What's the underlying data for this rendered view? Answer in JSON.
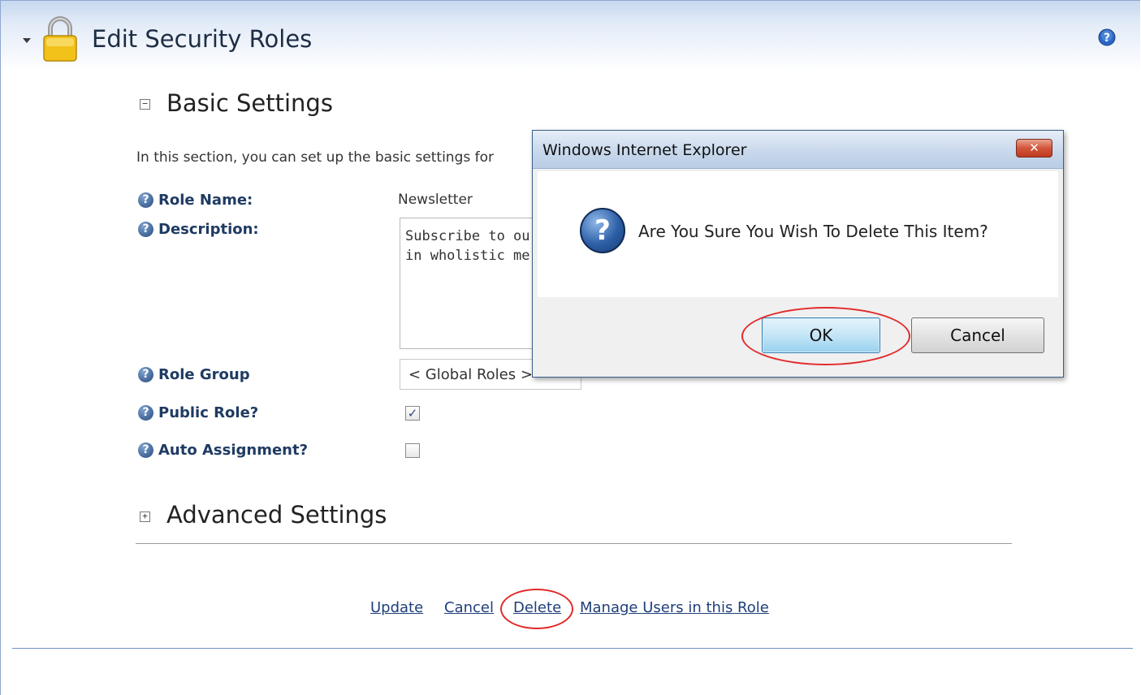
{
  "header": {
    "title": "Edit Security Roles"
  },
  "basic_settings": {
    "toggle": "−",
    "title": "Basic Settings",
    "intro": "In this section, you can set up the basic settings for"
  },
  "fields": {
    "role_name_label": "Role Name:",
    "role_name_value": "Newsletter",
    "description_label": "Description:",
    "description_value": "Subscribe to ou\nin wholistic me",
    "role_group_label": "Role Group",
    "role_group_value": "< Global Roles >",
    "public_role_label": "Public Role?",
    "public_role_checked": true,
    "auto_assignment_label": "Auto Assignment?",
    "auto_assignment_checked": false
  },
  "advanced_settings": {
    "toggle": "+",
    "title": "Advanced Settings"
  },
  "actions": {
    "update": "Update",
    "cancel": "Cancel",
    "delete": "Delete",
    "manage_users": "Manage Users in this Role"
  },
  "dialog": {
    "title": "Windows Internet Explorer",
    "message": "Are You Sure You Wish To Delete This Item?",
    "ok": "OK",
    "cancel": "Cancel"
  },
  "colors": {
    "annotation_circle": "#e22a2a",
    "link": "#1f3f7a",
    "label": "#1f3b63"
  }
}
